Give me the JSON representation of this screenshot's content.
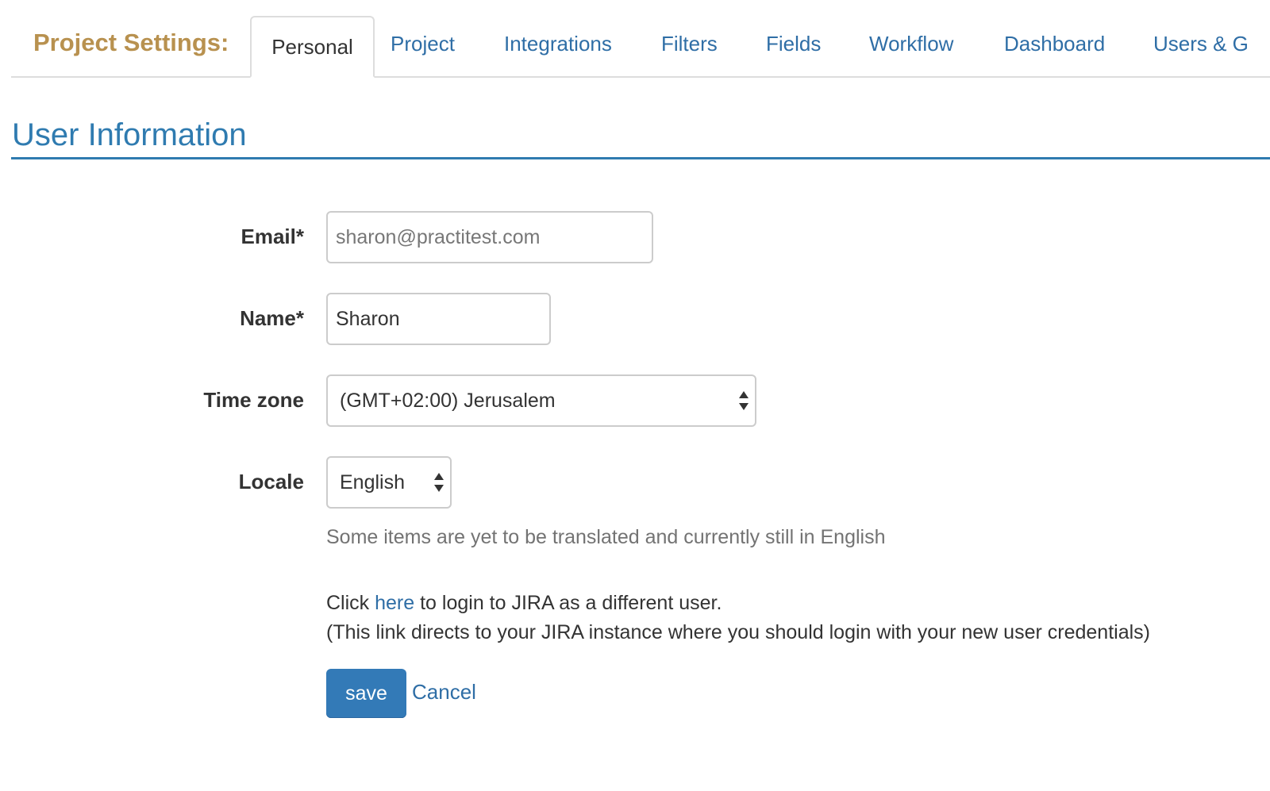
{
  "header": {
    "title": "Project Settings:",
    "tabs": [
      {
        "label": "Personal"
      },
      {
        "label": "Project"
      },
      {
        "label": "Integrations"
      },
      {
        "label": "Filters"
      },
      {
        "label": "Fields"
      },
      {
        "label": "Workflow"
      },
      {
        "label": "Dashboard"
      },
      {
        "label": "Users & G"
      }
    ],
    "active_tab": "Personal"
  },
  "section": {
    "title": "User Information"
  },
  "form": {
    "email": {
      "label": "Email*",
      "value": "sharon@practitest.com"
    },
    "name": {
      "label": "Name*",
      "value": "Sharon"
    },
    "timezone": {
      "label": "Time zone",
      "value": "(GMT+02:00) Jerusalem"
    },
    "locale": {
      "label": "Locale",
      "value": "English",
      "hint": "Some items are yet to be translated and currently still in English"
    },
    "jira": {
      "line1_prefix": "Click ",
      "link_text": "here",
      "line1_suffix": " to login to JIRA as a different user.",
      "line2": "(This link directs to your JIRA instance where you should login with your new user credentials)"
    },
    "save_label": "save",
    "cancel_label": "Cancel"
  },
  "icons": {
    "select_arrows": "up-down-chevron-icon"
  },
  "colors": {
    "title_gold": "#b8914f",
    "link_blue": "#2f6ea6",
    "heading_blue": "#2f7bb0",
    "button_blue": "#337ab7"
  }
}
